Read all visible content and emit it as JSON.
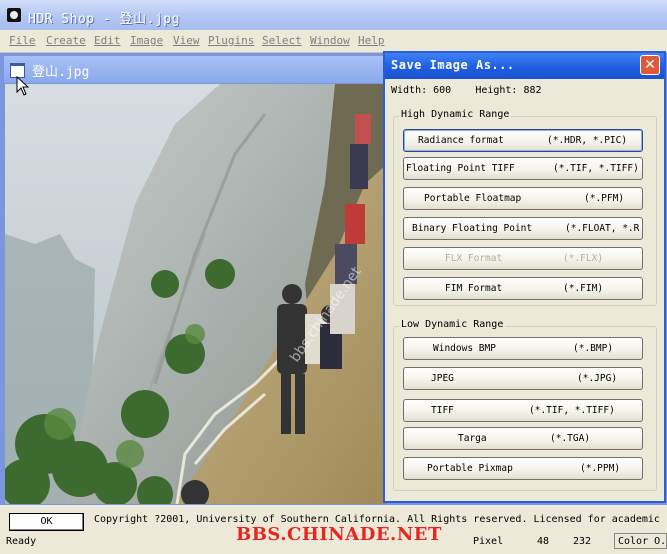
{
  "app": {
    "title": "HDR Shop - 登山.jpg",
    "icon": "hdr-shop-app-icon"
  },
  "menu": [
    "File",
    "Create",
    "Edit",
    "Image",
    "View",
    "Plugins",
    "Select",
    "Window",
    "Help"
  ],
  "document": {
    "title": "登山.jpg",
    "photo_watermark": "bbs.chinade.net"
  },
  "dialog": {
    "title": "Save Image As...",
    "width_label": "Width: 600",
    "height_label": "Height: 882",
    "close_glyph": "✕",
    "high_group": "High Dynamic Range",
    "low_group": "Low Dynamic Range",
    "high_formats": [
      {
        "name": "Radiance format",
        "ext": "(*.HDR, *.PIC)",
        "enabled": true,
        "default": true
      },
      {
        "name": "Floating Point TIFF",
        "ext": "(*.TIF, *.TIFF)",
        "enabled": true
      },
      {
        "name": "Portable Floatmap",
        "ext": "(*.PFM)",
        "enabled": true
      },
      {
        "name": "Binary Floating Point",
        "ext": "(*.FLOAT, *.R",
        "enabled": true
      },
      {
        "name": "FLX Format",
        "ext": "(*.FLX)",
        "enabled": false
      },
      {
        "name": "FIM Format",
        "ext": "(*.FIM)",
        "enabled": true
      }
    ],
    "low_formats": [
      {
        "name": "Windows BMP",
        "ext": "(*.BMP)",
        "enabled": true
      },
      {
        "name": "JPEG",
        "ext": "(*.JPG)",
        "enabled": true
      },
      {
        "name": "TIFF",
        "ext": "(*.TIF, *.TIFF)",
        "enabled": true
      },
      {
        "name": "Targa",
        "ext": "(*.TGA)",
        "enabled": true
      },
      {
        "name": "Portable Pixmap",
        "ext": "(*.PPM)",
        "enabled": true
      }
    ]
  },
  "footer": {
    "ok_label": "OK",
    "copyright": "Copyright ?2001, University of Southern California.  All Rights reserved.  Licensed for academic"
  },
  "status": {
    "ready": "Ready",
    "pixel_label": "Pixel",
    "x": "48",
    "y": "232",
    "color_label": "Color O."
  },
  "watermark": "BBS.CHINADE.NET",
  "colors": {
    "dialog_title_blue": "#1f5ee0",
    "watermark_red": "#e8261f"
  }
}
